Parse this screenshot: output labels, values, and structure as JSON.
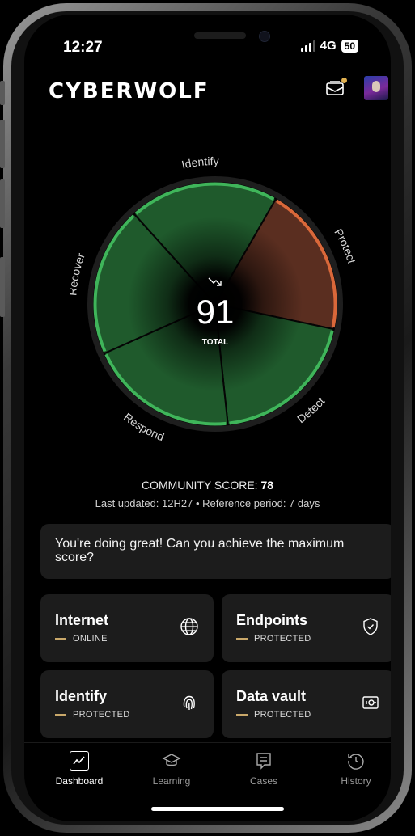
{
  "status_bar": {
    "time": "12:27",
    "network": "4G",
    "battery": "50"
  },
  "header": {
    "logo": "CYBERWOLF",
    "mail_icon": "mail-icon",
    "avatar": "user-avatar"
  },
  "chart_data": {
    "type": "pie",
    "title": "",
    "center_value": "91",
    "center_label": "TOTAL",
    "trend_icon": "trend-down-icon",
    "segments": [
      {
        "name": "Identify",
        "status": "good",
        "color": "#3fb55a"
      },
      {
        "name": "Protect",
        "status": "warning",
        "color": "#d9683a"
      },
      {
        "name": "Detect",
        "status": "good",
        "color": "#3fb55a"
      },
      {
        "name": "Respond",
        "status": "good",
        "color": "#3fb55a"
      },
      {
        "name": "Recover",
        "status": "good",
        "color": "#3fb55a"
      }
    ]
  },
  "community": {
    "label": "COMMUNITY SCORE:",
    "value": "78"
  },
  "updated_text": "Last updated: 12H27 • Reference period: 7 days",
  "banner_text": "You're doing great! Can you achieve the maximum score?",
  "cards": [
    {
      "title": "Internet",
      "status": "ONLINE",
      "icon": "globe-icon"
    },
    {
      "title": "Endpoints",
      "status": "PROTECTED",
      "icon": "shield-check-icon"
    },
    {
      "title": "Identify",
      "status": "PROTECTED",
      "icon": "fingerprint-icon"
    },
    {
      "title": "Data vault",
      "status": "PROTECTED",
      "icon": "vault-icon"
    }
  ],
  "nav": [
    {
      "label": "Dashboard",
      "icon": "chart-icon",
      "active": true
    },
    {
      "label": "Learning",
      "icon": "graduation-cap-icon",
      "active": false
    },
    {
      "label": "Cases",
      "icon": "document-icon",
      "active": false
    },
    {
      "label": "History",
      "icon": "history-icon",
      "active": false
    }
  ],
  "colors": {
    "accent_green": "#3fb55a",
    "accent_orange": "#d9683a",
    "status_dash": "#c9a86a",
    "card_bg": "#1c1c1c"
  }
}
